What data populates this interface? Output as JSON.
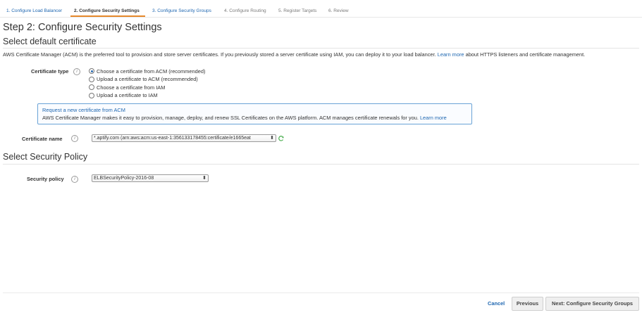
{
  "wizard": {
    "tabs": [
      "1. Configure Load Balancer",
      "2. Configure Security Settings",
      "3. Configure Security Groups",
      "4. Configure Routing",
      "5. Register Targets",
      "6. Review"
    ]
  },
  "page": {
    "title": "Step 2: Configure Security Settings",
    "section1_title": "Select default certificate",
    "description_pre": "AWS Certificate Manager (ACM) is the preferred tool to provision and store server certificates. If you previously stored a server certificate using IAM, you can deploy it to your load balancer.",
    "description_link": "Learn more",
    "description_post": "about HTTPS listeners and certificate management.",
    "certificate_type_label": "Certificate type",
    "radio_options": [
      "Choose a certificate from ACM (recommended)",
      "Upload a certificate to ACM (recommended)",
      "Choose a certificate from IAM",
      "Upload a certificate to IAM"
    ],
    "selected_radio": 0,
    "infobox_title": "Request a new certificate from ACM",
    "infobox_text": "AWS Certificate Manager makes it easy to provision, manage, deploy, and renew SSL Certificates on the AWS platform. ACM manages certificate renewals for you.",
    "infobox_link": "Learn more",
    "certificate_name_label": "Certificate name",
    "certificate_name_value": "*.aptify.com (arn:aws:acm:us-east-1:356133178455:certificate/e1665eat",
    "section2_title": "Select Security Policy",
    "security_policy_label": "Security policy",
    "security_policy_value": "ELBSecurityPolicy-2016-08"
  },
  "footer": {
    "cancel": "Cancel",
    "previous": "Previous",
    "next": "Next: Configure Security Groups"
  },
  "colors": {
    "link": "#1f67b1",
    "active_tab_underline": "#e6892a",
    "infobox_border": "#6aa3d6"
  },
  "icons": {
    "info": "info-icon",
    "refresh": "refresh-icon",
    "dropdown": "chevron-updown-icon"
  }
}
